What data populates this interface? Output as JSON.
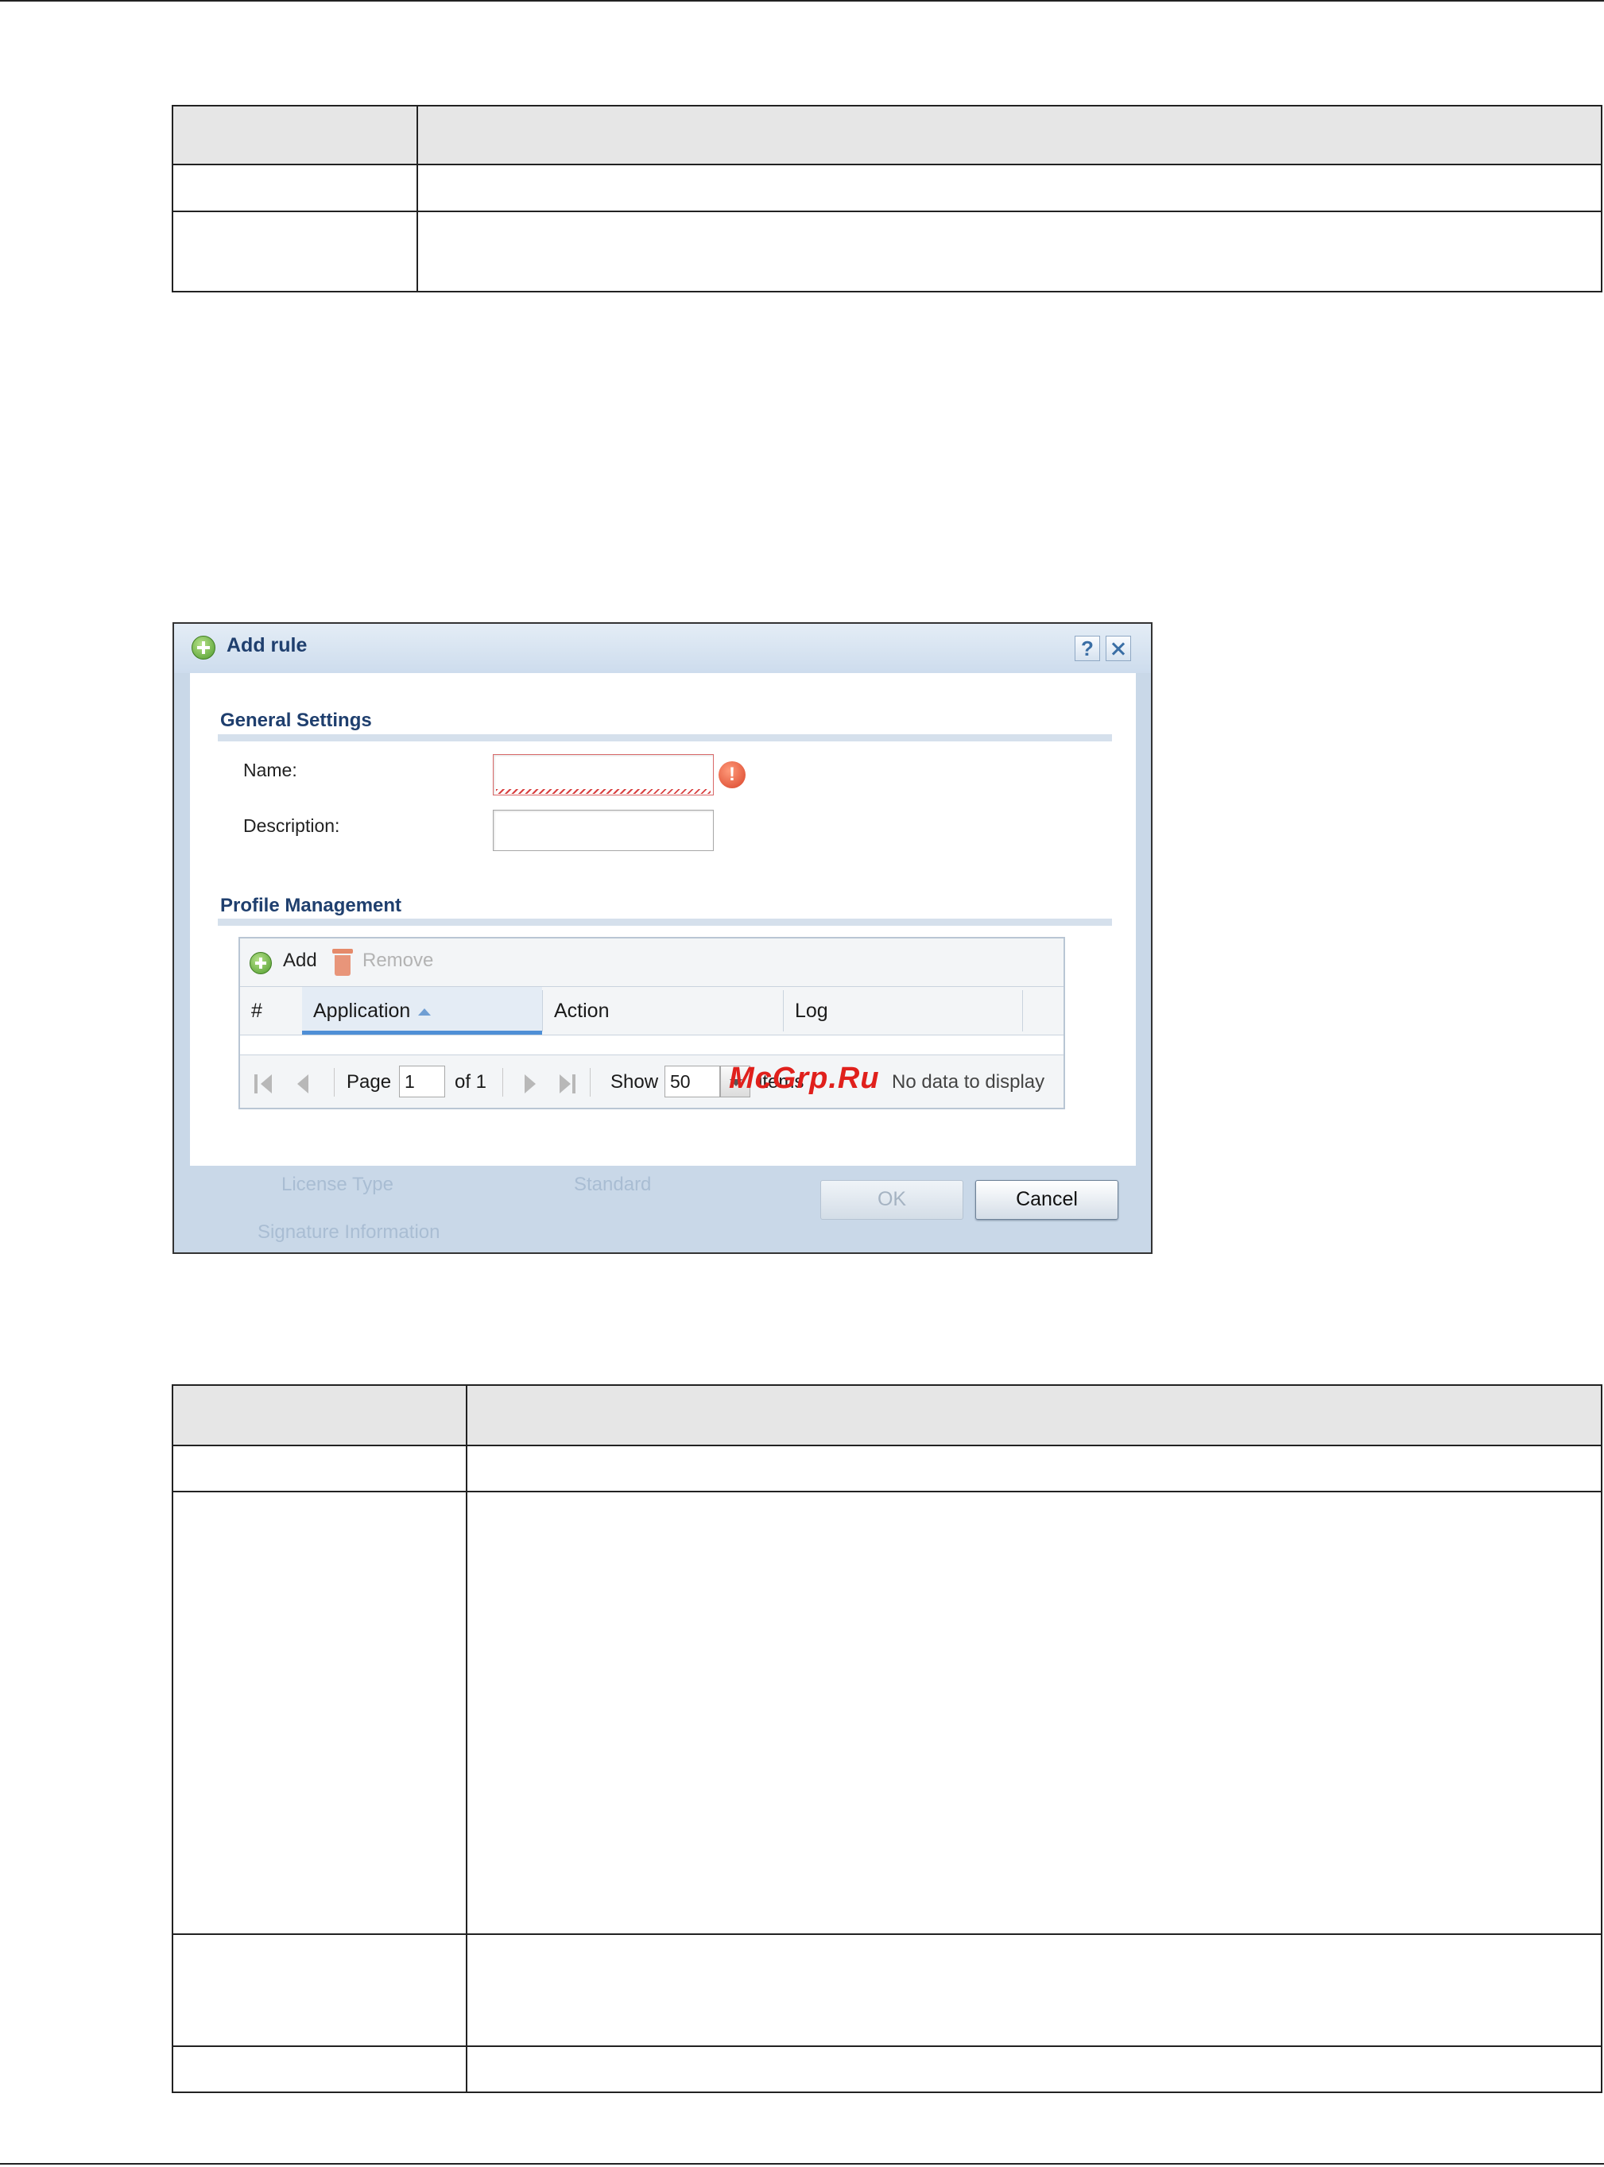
{
  "dialog": {
    "title": "Add rule",
    "help_label": "?",
    "general_settings": {
      "title": "General Settings",
      "name_label": "Name:",
      "name_value": "",
      "description_label": "Description:",
      "description_value": "",
      "name_error_icon": "!"
    },
    "profile_management": {
      "title": "Profile Management",
      "toolbar": {
        "add_label": "Add",
        "remove_label": "Remove"
      },
      "columns": [
        "#",
        "Application",
        "Action",
        "Log"
      ],
      "sorted_column": "Application",
      "pager": {
        "page_label": "Page",
        "page_value": "1",
        "of_label": "of 1",
        "show_label": "Show",
        "show_value": "50",
        "items_label": "items",
        "empty_message": "No data to display"
      }
    },
    "background_text": {
      "license_type": "License Type",
      "standard": "Standard",
      "signature_info": "Signature Information"
    },
    "buttons": {
      "ok": "OK",
      "cancel": "Cancel"
    }
  },
  "watermark": "McGrp.Ru",
  "colors": {
    "title_text": "#1f3f6e",
    "dialog_frame": "#c9d8e8",
    "error": "#d9442a",
    "watermark": "#e0201c"
  }
}
